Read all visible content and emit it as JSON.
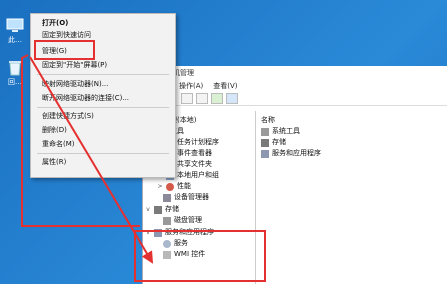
{
  "desktop": {
    "icons": [
      {
        "label": "此…",
        "icon": "computer-icon"
      },
      {
        "label": "回…",
        "icon": "recycle-bin-icon"
      }
    ]
  },
  "context_menu": {
    "items": [
      {
        "label": "打开(O)",
        "bold": true
      },
      {
        "label": "固定到快速访问"
      },
      {
        "label": "管理(G)"
      },
      {
        "label": "固定到\"开始\"屏幕(P)"
      },
      {
        "label": "映射网络驱动器(N)..."
      },
      {
        "label": "断开网络驱动器的连接(C)..."
      },
      {
        "label": "创建快捷方式(S)"
      },
      {
        "label": "删除(D)"
      },
      {
        "label": "重命名(M)"
      },
      {
        "label": "属性(R)"
      }
    ]
  },
  "window": {
    "title": "机管理",
    "menu": [
      "操作(A)",
      "查看(V)"
    ],
    "tree": [
      {
        "label": "机管理(本地)",
        "exp": ""
      },
      {
        "label": "系统工具",
        "exp": ""
      },
      {
        "label": "任务计划程序",
        "exp": ">"
      },
      {
        "label": "事件查看器",
        "exp": ">"
      },
      {
        "label": "共享文件夹",
        "exp": ">"
      },
      {
        "label": "本地用户和组",
        "exp": ">"
      },
      {
        "label": "性能",
        "exp": ">"
      },
      {
        "label": "设备管理器",
        "exp": ""
      },
      {
        "label": "存储",
        "exp": "v"
      },
      {
        "label": "磁盘管理",
        "exp": ""
      },
      {
        "label": "服务和应用程序",
        "exp": "v"
      },
      {
        "label": "服务",
        "exp": ""
      },
      {
        "label": "WMI 控件",
        "exp": ""
      }
    ],
    "right_header": "名称",
    "right_items": [
      "系统工具",
      "存储",
      "服务和应用程序"
    ]
  },
  "annotation_color": "#e53030"
}
